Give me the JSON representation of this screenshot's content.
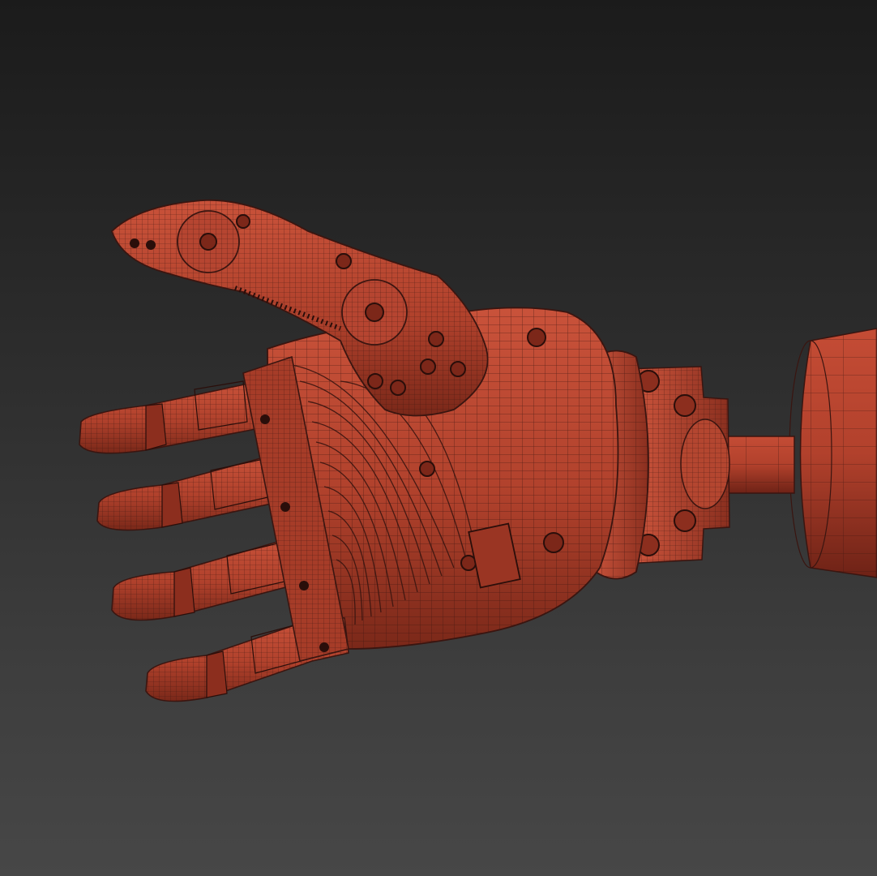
{
  "scene": {
    "background_top": "#1b1b1b",
    "background_bottom": "#474747",
    "model_color": "#b8432e",
    "model_highlight": "#d0563d",
    "model_shadow": "#6e2418",
    "wire_color": "#3a1510",
    "objects": [
      "forearm-cylinder",
      "wrist-shaft",
      "wrist-mount-bracket",
      "wrist-flange-disc",
      "palm-shell",
      "thumb",
      "index-finger",
      "middle-finger",
      "ring-finger",
      "pinky-finger"
    ]
  }
}
